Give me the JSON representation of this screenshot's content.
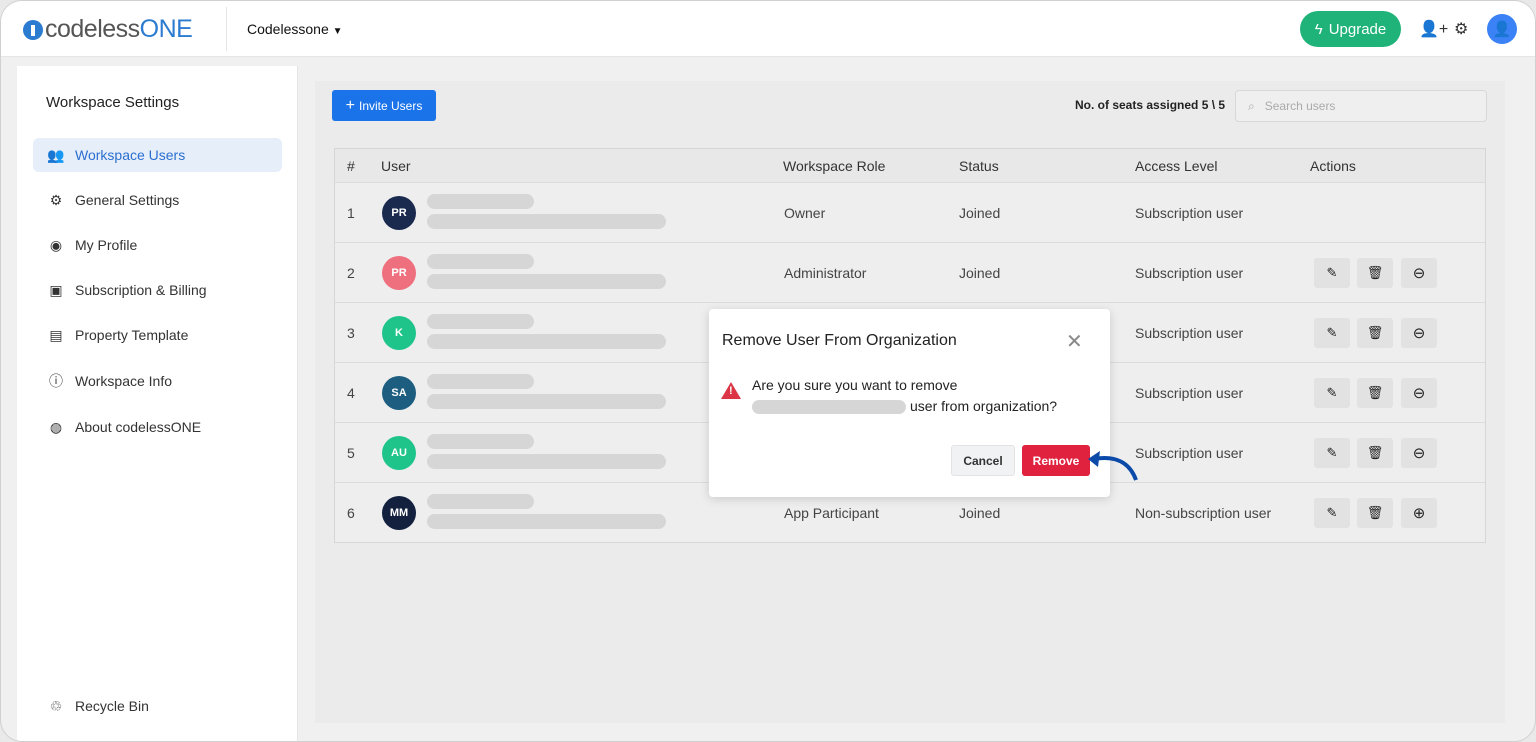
{
  "header": {
    "logo_text_a": "codeless",
    "logo_text_b": "ONE",
    "workspace": "Codelessone",
    "upgrade": "Upgrade"
  },
  "sidebar": {
    "title": "Workspace Settings",
    "items": [
      {
        "label": "Workspace Users",
        "icon": "users-icon"
      },
      {
        "label": "General Settings",
        "icon": "gear-icon"
      },
      {
        "label": "My Profile",
        "icon": "user-circle-icon"
      },
      {
        "label": "Subscription & Billing",
        "icon": "money-icon"
      },
      {
        "label": "Property Template",
        "icon": "document-icon"
      },
      {
        "label": "Workspace Info",
        "icon": "info-icon"
      },
      {
        "label": "About codelessONE",
        "icon": "logo-icon"
      }
    ],
    "recycle": "Recycle Bin"
  },
  "toolbar": {
    "invite": "Invite Users",
    "seats": "No. of seats assigned 5 \\ 5",
    "search_placeholder": "Search users"
  },
  "table": {
    "headers": [
      "#",
      "User",
      "Workspace Role",
      "Status",
      "Access Level",
      "Actions"
    ],
    "rows": [
      {
        "n": "1",
        "initials": "PR",
        "color": "#1a2a4f",
        "role": "Owner",
        "status": "Joined",
        "access": "Subscription user",
        "actions": false,
        "toggle": ""
      },
      {
        "n": "2",
        "initials": "PR",
        "color": "#ee6f7d",
        "role": "Administrator",
        "status": "Joined",
        "access": "Subscription user",
        "actions": true,
        "toggle": "⊖"
      },
      {
        "n": "3",
        "initials": "K",
        "color": "#1fc48a",
        "role": "",
        "status": "",
        "access": "Subscription user",
        "actions": true,
        "toggle": "⊖"
      },
      {
        "n": "4",
        "initials": "SA",
        "color": "#1d5d80",
        "role": "",
        "status": "",
        "access": "Subscription user",
        "actions": true,
        "toggle": "⊖"
      },
      {
        "n": "5",
        "initials": "AU",
        "color": "#1fc48a",
        "role": "",
        "status": "",
        "access": "Subscription user",
        "actions": true,
        "toggle": "⊖"
      },
      {
        "n": "6",
        "initials": "MM",
        "color": "#13213f",
        "role": "App Participant",
        "status": "Joined",
        "access": "Non-subscription user",
        "actions": true,
        "toggle": "⊕"
      }
    ]
  },
  "modal": {
    "title": "Remove User From Organization",
    "line1": "Are you sure you want to remove",
    "line2": "user from organization?",
    "cancel": "Cancel",
    "remove": "Remove"
  },
  "colors": {
    "accent": "#1a73e8",
    "upgrade": "#1fb37a",
    "danger": "#e0223f"
  }
}
